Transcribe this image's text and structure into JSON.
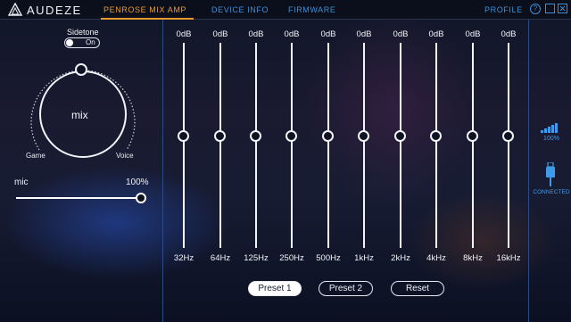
{
  "header": {
    "brand": "AUDEZE",
    "tabs": [
      {
        "label": "PENROSE MIX AMP",
        "active": true
      },
      {
        "label": "DEVICE INFO",
        "active": false
      },
      {
        "label": "FIRMWARE",
        "active": false
      }
    ],
    "profile_label": "PROFILE",
    "help_label": "?"
  },
  "mixer": {
    "sidetone_label": "Sidetone",
    "sidetone_state": "On",
    "dial_label": "mix",
    "dial_left_label": "Game",
    "dial_right_label": "Voice",
    "mic_label": "mic",
    "mic_value": "100%"
  },
  "eq": {
    "bands": [
      {
        "db": "0dB",
        "freq": "32Hz"
      },
      {
        "db": "0dB",
        "freq": "64Hz"
      },
      {
        "db": "0dB",
        "freq": "125Hz"
      },
      {
        "db": "0dB",
        "freq": "250Hz"
      },
      {
        "db": "0dB",
        "freq": "500Hz"
      },
      {
        "db": "0dB",
        "freq": "1kHz"
      },
      {
        "db": "0dB",
        "freq": "2kHz"
      },
      {
        "db": "0dB",
        "freq": "4kHz"
      },
      {
        "db": "0dB",
        "freq": "8kHz"
      },
      {
        "db": "0dB",
        "freq": "16kHz"
      }
    ],
    "presets": [
      {
        "label": "Preset 1",
        "active": true
      },
      {
        "label": "Preset 2",
        "active": false
      },
      {
        "label": "Reset",
        "active": false
      }
    ]
  },
  "status": {
    "battery_text": "100%",
    "connection_text": "CONNECTED"
  },
  "colors": {
    "accent_active": "#e89a2c",
    "accent_link": "#3f8fd6",
    "status_blue": "#3f9be8"
  }
}
